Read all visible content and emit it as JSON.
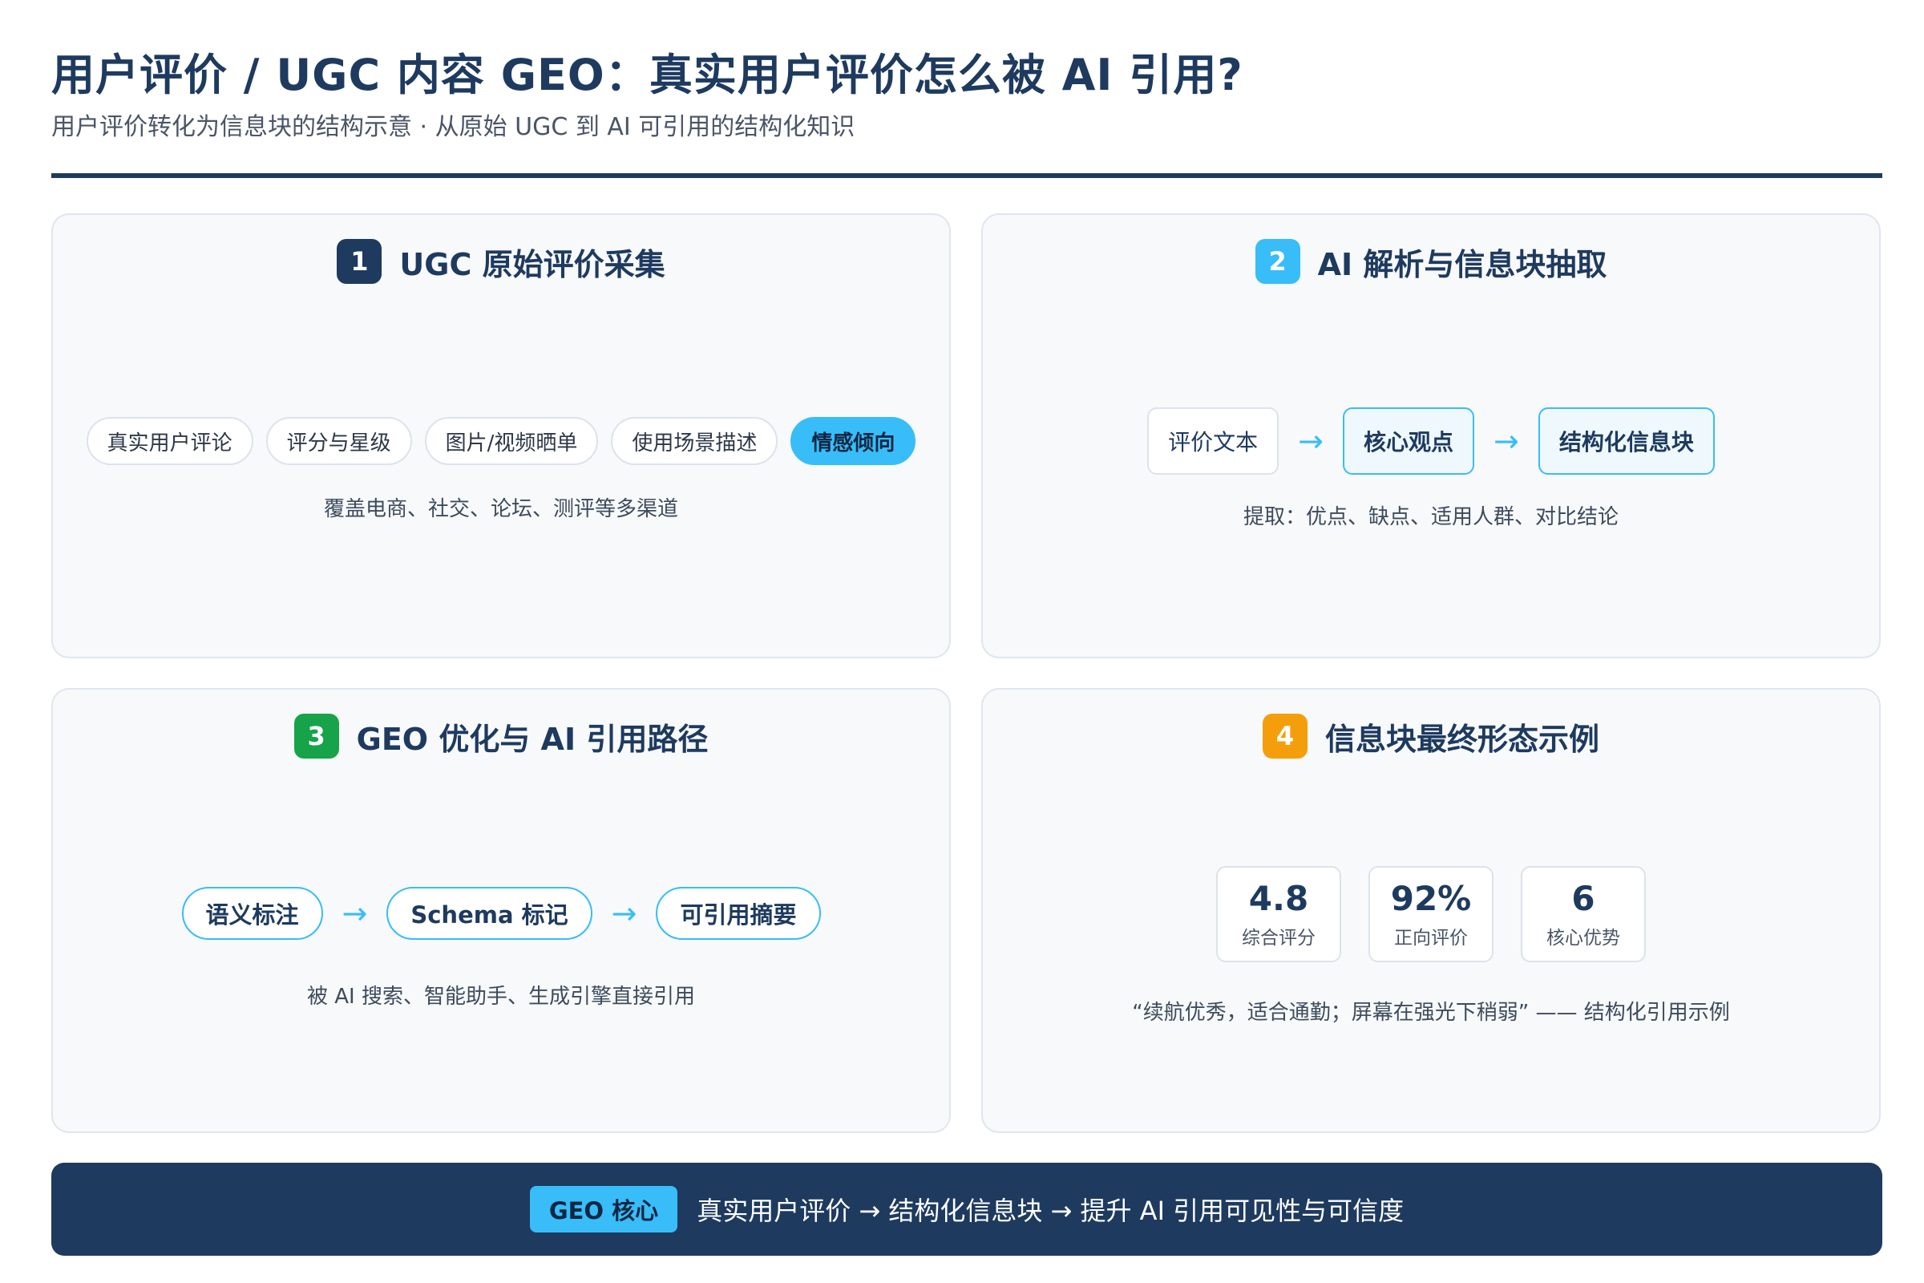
{
  "header": {
    "title": "用户评价 / UGC 内容 GEO：真实用户评价怎么被 AI 引用?",
    "subtitle": "用户评价转化为信息块的结构示意 · 从原始 UGC 到 AI 可引用的结构化知识"
  },
  "colors": {
    "navy": "#1e3a5f",
    "sky": "#38bdf8",
    "green": "#16a34a",
    "amber": "#f59e0b"
  },
  "panels": {
    "ugc": {
      "number": "1",
      "title": "UGC 原始评价采集",
      "chips": [
        "真实用户评论",
        "评分与星级",
        "图片/视频晒单",
        "使用场景描述",
        "情感倾向"
      ],
      "note": "覆盖电商、社交、论坛、测评等多渠道"
    },
    "ai": {
      "number": "2",
      "title": "AI 解析与信息块抽取",
      "flow": [
        "评价文本",
        "核心观点",
        "结构化信息块"
      ],
      "note": "提取：优点、缺点、适用人群、对比结论"
    },
    "geo": {
      "number": "3",
      "title": "GEO 优化与 AI 引用路径",
      "flow": [
        "语义标注",
        "Schema 标记",
        "可引用摘要"
      ],
      "note": "被 AI 搜索、智能助手、生成引擎直接引用"
    },
    "example": {
      "number": "4",
      "title": "信息块最终形态示例",
      "stats": [
        {
          "value": "4.8",
          "label": "综合评分"
        },
        {
          "value": "92%",
          "label": "正向评价"
        },
        {
          "value": "6",
          "label": "核心优势"
        }
      ],
      "quote": "“续航优秀，适合通勤；屏幕在强光下稍弱”  —— 结构化引用示例"
    }
  },
  "footer": {
    "badge": "GEO 核心",
    "text": "真实用户评价 → 结构化信息块 → 提升 AI 引用可见性与可信度"
  }
}
